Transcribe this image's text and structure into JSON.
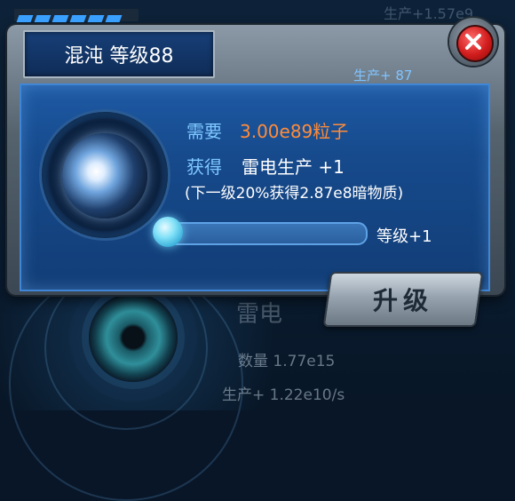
{
  "background": {
    "top_production": "生产+1.57e9",
    "item_name": "雷电",
    "count": "数量 1.77e15",
    "production": "生产+ 1.22e10/s"
  },
  "dialog": {
    "title": "混沌 等级88",
    "production": "生产+ 87",
    "need_label": "需要",
    "need_value": "3.00e89粒子",
    "gain_label": "获得",
    "gain_value": "雷电生产 +1",
    "next_info": "(下一级20%获得2.87e8暗物质)",
    "progress_fraction": 0.0,
    "level_up_text": "等级+1",
    "upgrade_label": "升级"
  },
  "colors": {
    "panel": "#164a8c",
    "accent": "#7fc8ff",
    "need_value": "#ff8c3a",
    "close": "#d11c1c"
  },
  "icons": [
    "chaos-orb-icon",
    "close-icon",
    "eye-orb-icon"
  ]
}
